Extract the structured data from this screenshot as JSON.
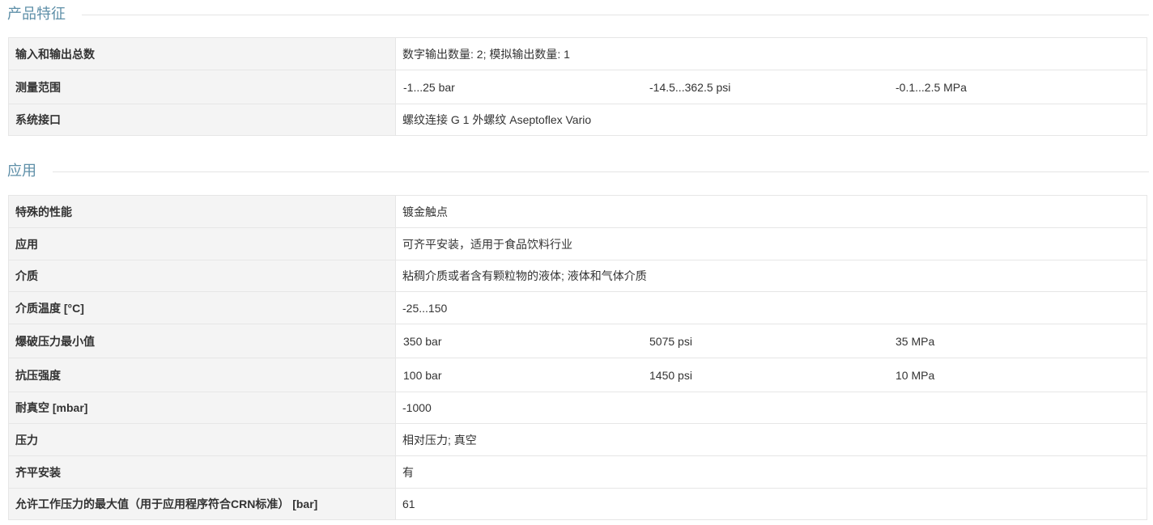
{
  "sections": [
    {
      "title": "产品特征",
      "rows": [
        {
          "label": "输入和输出总数",
          "values": [
            "数字输出数量: 2; 模拟输出数量: 1"
          ]
        },
        {
          "label": "测量范围",
          "values": [
            "-1...25 bar",
            "-14.5...362.5 psi",
            "-0.1...2.5 MPa"
          ]
        },
        {
          "label": "系统接口",
          "values": [
            "螺纹连接 G 1 外螺纹 Aseptoflex Vario"
          ]
        }
      ]
    },
    {
      "title": "应用",
      "rows": [
        {
          "label": "特殊的性能",
          "values": [
            "镀金触点"
          ]
        },
        {
          "label": "应用",
          "values": [
            "可齐平安装，适用于食品饮料行业"
          ]
        },
        {
          "label": "介质",
          "values": [
            "粘稠介质或者含有颗粒物的液体; 液体和气体介质"
          ]
        },
        {
          "label": "介质温度 [°C]",
          "values": [
            "-25...150"
          ]
        },
        {
          "label": "爆破压力最小值",
          "values": [
            "350 bar",
            "5075 psi",
            "35 MPa"
          ]
        },
        {
          "label": "抗压强度",
          "values": [
            "100 bar",
            "1450 psi",
            "10 MPa"
          ]
        },
        {
          "label": "耐真空 [mbar]",
          "values": [
            "-1000"
          ]
        },
        {
          "label": "压力",
          "values": [
            "相对压力; 真空"
          ]
        },
        {
          "label": "齐平安装",
          "values": [
            "有"
          ]
        },
        {
          "label": "允许工作压力的最大值（用于应用程序符合CRN标准） [bar]",
          "values": [
            "61"
          ]
        }
      ]
    }
  ]
}
